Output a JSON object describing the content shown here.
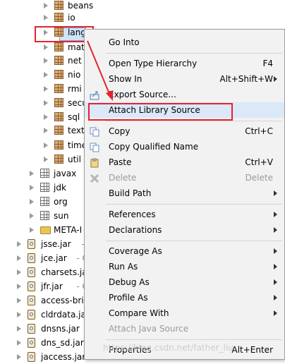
{
  "tree": {
    "items": [
      {
        "label": "beans",
        "icon": "package-icon",
        "depth": 2
      },
      {
        "label": "io",
        "icon": "package-icon",
        "depth": 2
      },
      {
        "label": "lang",
        "icon": "package-icon",
        "depth": 2,
        "selected": true
      },
      {
        "label": "mat",
        "icon": "package-icon",
        "depth": 2
      },
      {
        "label": "net",
        "icon": "package-icon",
        "depth": 2
      },
      {
        "label": "nio",
        "icon": "package-icon",
        "depth": 2
      },
      {
        "label": "rmi",
        "icon": "package-icon",
        "depth": 2
      },
      {
        "label": "secu",
        "icon": "package-icon",
        "depth": 2
      },
      {
        "label": "sql",
        "icon": "package-icon",
        "depth": 2
      },
      {
        "label": "text",
        "icon": "package-icon",
        "depth": 2
      },
      {
        "label": "time",
        "icon": "package-icon",
        "depth": 2
      },
      {
        "label": "util",
        "icon": "package-icon",
        "depth": 2
      },
      {
        "label": "javax",
        "icon": "package-icon",
        "depth": 1
      },
      {
        "label": "jdk",
        "icon": "package-icon",
        "depth": 1
      },
      {
        "label": "org",
        "icon": "package-icon",
        "depth": 1
      },
      {
        "label": "sun",
        "icon": "package-icon",
        "depth": 1
      },
      {
        "label": "META-I",
        "icon": "folder-icon",
        "depth": 1
      },
      {
        "label": "jsse.jar",
        "suffix": " - C",
        "icon": "jar-icon",
        "depth": 0
      },
      {
        "label": "jce.jar",
        "suffix": " - C:\\",
        "icon": "jar-icon",
        "depth": 0
      },
      {
        "label": "charsets.ja",
        "icon": "jar-icon",
        "depth": 0
      },
      {
        "label": "jfr.jar",
        "suffix": " - C:\\",
        "icon": "jar-icon",
        "depth": 0
      },
      {
        "label": "access-bri",
        "icon": "jar-icon",
        "depth": 0
      },
      {
        "label": "cldrdata.ja",
        "icon": "jar-icon",
        "depth": 0
      },
      {
        "label": "dnsns.jar",
        "suffix": " -",
        "icon": "jar-icon",
        "depth": 0
      },
      {
        "label": "dns_sd.jar",
        "icon": "jar-icon",
        "depth": 0
      },
      {
        "label": "jaccess.jar",
        "icon": "jar-icon",
        "depth": 0
      }
    ]
  },
  "menu": {
    "items": [
      {
        "label": "Go Into",
        "shortcut": "",
        "submenu": false,
        "disabled": false
      },
      {
        "sep": true
      },
      {
        "label": "Open Type Hierarchy",
        "shortcut": "F4",
        "submenu": false,
        "disabled": false
      },
      {
        "label": "Show In",
        "shortcut": "Alt+Shift+W",
        "submenu": true,
        "disabled": false
      },
      {
        "label": "Export Source...",
        "shortcut": "",
        "submenu": false,
        "disabled": false,
        "icon": "export-icon"
      },
      {
        "label": "Attach Library Source",
        "shortcut": "",
        "submenu": false,
        "disabled": false,
        "hover": true
      },
      {
        "sep": true
      },
      {
        "label": "Copy",
        "shortcut": "Ctrl+C",
        "submenu": false,
        "disabled": false,
        "icon": "copy-icon"
      },
      {
        "label": "Copy Qualified Name",
        "shortcut": "",
        "submenu": false,
        "disabled": false,
        "icon": "copy-qualified-icon"
      },
      {
        "label": "Paste",
        "shortcut": "Ctrl+V",
        "submenu": false,
        "disabled": false,
        "icon": "paste-icon"
      },
      {
        "label": "Delete",
        "shortcut": "Delete",
        "submenu": false,
        "disabled": true,
        "icon": "delete-icon"
      },
      {
        "label": "Build Path",
        "shortcut": "",
        "submenu": true,
        "disabled": false
      },
      {
        "sep": true
      },
      {
        "label": "References",
        "shortcut": "",
        "submenu": true,
        "disabled": false
      },
      {
        "label": "Declarations",
        "shortcut": "",
        "submenu": true,
        "disabled": false
      },
      {
        "sep": true
      },
      {
        "label": "Coverage As",
        "shortcut": "",
        "submenu": true,
        "disabled": false
      },
      {
        "label": "Run As",
        "shortcut": "",
        "submenu": true,
        "disabled": false
      },
      {
        "label": "Debug As",
        "shortcut": "",
        "submenu": true,
        "disabled": false
      },
      {
        "label": "Profile As",
        "shortcut": "",
        "submenu": true,
        "disabled": false
      },
      {
        "label": "Compare With",
        "shortcut": "",
        "submenu": true,
        "disabled": false
      },
      {
        "label": "Attach Java Source",
        "shortcut": "",
        "submenu": false,
        "disabled": true
      },
      {
        "sep": true
      },
      {
        "label": "Properties",
        "shortcut": "Alt+Enter",
        "submenu": false,
        "disabled": false
      }
    ]
  },
  "watermark": "https://blog.csdn.net/father_liu",
  "colors": {
    "highlight": "#e6232e",
    "hover": "#dbe8f7",
    "menu_bg": "#f2f2f2"
  }
}
